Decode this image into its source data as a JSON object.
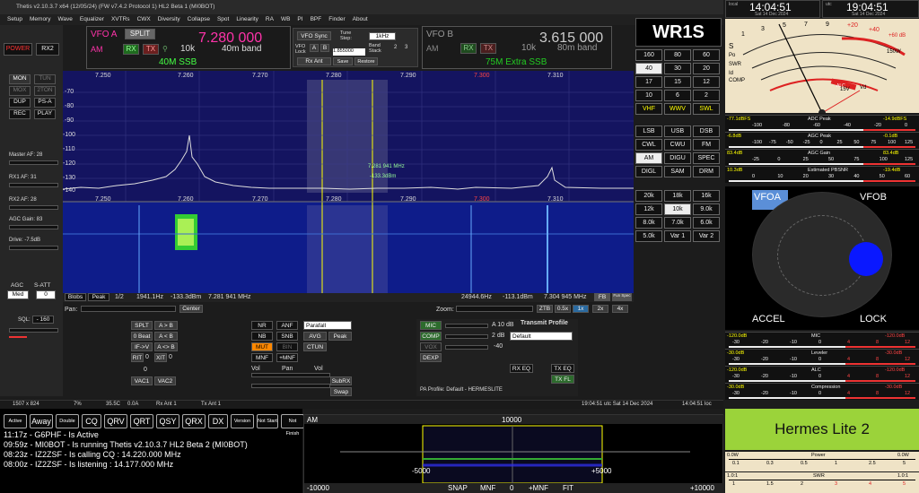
{
  "window": {
    "title": "Thetis v2.10.3.7 x64 (12/05/24) (FW v7.4.2 Protocol 1) HL2 Beta 1 (MI0BOT)"
  },
  "menu": [
    "Setup",
    "Memory",
    "Wave",
    "Equalizer",
    "XVTRs",
    "CWX",
    "Diversity",
    "Collapse",
    "Spot",
    "Linearity",
    "RA",
    "WB",
    "PI",
    "BPF",
    "Finder",
    "About"
  ],
  "left": {
    "power": "POWER",
    "rx2": "RX2",
    "mon": "MON",
    "tun": "TUN",
    "mox": "MOX",
    "twotone": "2TON",
    "dup": "DUP",
    "psa": "PS-A",
    "rec": "REC",
    "play": "PLAY",
    "master_af": "Master AF:  28",
    "rx1_af": "RX1 AF:  31",
    "rx2_af": "RX2 AF:  28",
    "agc_gain": "AGC Gain:  83",
    "drive": "Drive:  -7.5dB",
    "agc": "AGC",
    "satt": "S-ATT",
    "agc_mode": "Med",
    "satt_val": "0",
    "sql": "SQL:",
    "sql_val": "- 160"
  },
  "vfoA": {
    "label": "VFO A",
    "split": "SPLIT",
    "freq": "7.280 000",
    "mode": "AM",
    "rx": "RX",
    "tx": "TX",
    "step": "10k",
    "band": "40m band",
    "band_name": "40M SSB"
  },
  "vfoSync": {
    "sync": "VFO Sync",
    "tune": "Tune Step:",
    "step": "1kHz",
    "lock": "VFO Lock",
    "a": "A",
    "b": "B",
    "bandstack": "Band Stack",
    "bs1": "2",
    "bs2": "3",
    "rxant": "Rx Ant",
    "save": "Save",
    "restore": "Restore",
    "mem": "1.855000"
  },
  "vfoB": {
    "label": "VFO B",
    "freq": "3.615 000",
    "mode": "AM",
    "rx": "RX",
    "tx": "TX",
    "step": "10k",
    "band": "80m band",
    "band_name": "75M Extra SSB"
  },
  "callsign": "WR1S",
  "bands": [
    "160",
    "80",
    "60",
    "40",
    "30",
    "20",
    "17",
    "15",
    "12",
    "10",
    "6",
    "2",
    "VHF",
    "WWV",
    "SWL"
  ],
  "modes": [
    "LSB",
    "USB",
    "DSB",
    "CWL",
    "CWU",
    "FM",
    "AM",
    "DIGU",
    "SPEC",
    "DIGL",
    "SAM",
    "DRM"
  ],
  "filters": [
    "20k",
    "18k",
    "16k",
    "12k",
    "10k",
    "9.0k",
    "8.0k",
    "7.0k",
    "6.0k",
    "5.0k",
    "Var 1",
    "Var 2"
  ],
  "panadapter": {
    "freqs": [
      "7.250",
      "7.260",
      "7.270",
      "7.280",
      "7.290",
      "7.300",
      "7.310"
    ],
    "db": [
      "-70",
      "-80",
      "-90",
      "-100",
      "-110",
      "-120",
      "-130",
      "-140"
    ],
    "cursor_freq": "7.281 941 MHz",
    "cursor_db": "-133.3dBm",
    "bottom_hz": "1941.1Hz",
    "bottom_dbm": "-133.3dBm",
    "bottom_mhz": "7.281 941 MHz",
    "right_hz": "24944.6Hz",
    "right_dbm": "-113.1dBm",
    "right_mhz": "7.304 945 MHz",
    "blobs": "Blobs",
    "peak": "Peak",
    "half": "1/2",
    "fb": "FB",
    "fun": "Fun Spec",
    "pan": "Pan:",
    "center": "Center",
    "zoom": "Zoom:",
    "ztb": "ZTB",
    "z05": "0.5x",
    "z1": "1x",
    "z2": "2x",
    "z4": "4x"
  },
  "dsp": {
    "split": "SPLT",
    "ab": "A > B",
    "zerobeat": "0 Beat",
    "atob": "A < B",
    "ifv": "IF->V",
    "aswap": "A <> B",
    "rit": "RIT",
    "rit_val": "0",
    "xit": "XIT",
    "xit_val": "0",
    "vac1": "VAC1",
    "vac2": "VAC2",
    "vac_val": "0",
    "nr": "NR",
    "anf": "ANF",
    "nb": "NB",
    "snb": "SNB",
    "mut": "MUT",
    "bin": "BIN",
    "mnf": "MNF",
    "pmnf": "+MNF",
    "parafall": "Parafall",
    "avg": "AVG",
    "peak": "Peak",
    "ctun": "CTUN",
    "vol": "Vol",
    "pan": "Pan",
    "vol2": "Vol",
    "subrx": "SubRX",
    "swap": "Swap"
  },
  "tx": {
    "mic": "MIC",
    "comp": "COMP",
    "vox": "VOX",
    "dexp": "DEXP",
    "mic_val": "A 10 dB",
    "comp_val": "2 dB",
    "vox_val": "-40",
    "profile_label": "Transmit Profile",
    "profile": "Default",
    "rxeq": "RX EQ",
    "txeq": "TX EQ",
    "txfl": "TX FL",
    "pa_profile": "PA Profile: Default - HERMESLITE"
  },
  "status": {
    "res": "1507 x 824",
    "cpu": "7%",
    "temp": "35.5C",
    "amps": "0.0A",
    "rxant": "Rx Ant 1",
    "txant": "Tx Ant 1",
    "utc": "19:04:51 utc  Sat 14 Dec 2024",
    "loc": "14:04:51 loc"
  },
  "chat": {
    "buttons": [
      "Active",
      "Away",
      "Double",
      "CQ",
      "QRV",
      "QRT",
      "QSY",
      "QRX",
      "DX",
      "Version",
      "Not Start",
      "Not Finish"
    ],
    "lines": [
      "11:17z - G6PHF - Is Active",
      "09:59z - MI0BOT - Is running Thetis v2.10.3.7 HL2 Beta 2 (MI0BOT)",
      "08:23z - IZ2ZSF - Is calling CQ : 14.220.000 MHz",
      "08:00z - IZ2ZSF - Is listening : 14.177.000 MHz"
    ]
  },
  "spectrum": {
    "mode": "AM",
    "center": "10000",
    "neg": "-5000",
    "pos": "+5000",
    "left": "-10000",
    "right": "+10000",
    "snap": "SNAP",
    "mnf": "MNF",
    "zero": "0",
    "pmnf": "+MNF",
    "fit": "FIT"
  },
  "clocks": {
    "local_label": "local",
    "local_time": "14:04:51",
    "local_date": "Sat 14 Dec 2024",
    "utc_label": "utc",
    "utc_time": "19:04:51",
    "utc_date": "Sat 14 Dec 2024"
  },
  "analog_meter": {
    "s": "S",
    "po": "Po",
    "swr": "SWR",
    "id": "Id",
    "comp": "COMP",
    "vd": "Vd",
    "v15": "15V",
    "s1": "1",
    "s3": "3",
    "s5": "5",
    "s7": "7",
    "s9": "9",
    "p20": "+20",
    "p40": "+40",
    "p60": "+60 dB",
    "w150": "150W",
    "alc": "ALC"
  },
  "meters": [
    {
      "left": "-77.1dBFS",
      "title": "ADC Peak",
      "right": "-14.9dBFS",
      "ticks": [
        "-100",
        "-80",
        "-60",
        "-40",
        "-20",
        "0"
      ]
    },
    {
      "left": "-6.8dB",
      "title": "AGC Peak",
      "right": "-0.1dB",
      "ticks": [
        "-100",
        "-75",
        "-50",
        "-25",
        "0",
        "25",
        "50",
        "75",
        "100",
        "125"
      ]
    },
    {
      "left": "83.4dB",
      "title": "AGC Gain",
      "right": "83.4dB",
      "ticks": [
        "-25",
        "0",
        "25",
        "50",
        "75",
        "100",
        "125"
      ]
    },
    {
      "left": "10.3dB",
      "title": "Estimated PBSNR",
      "right": "-19.4dB",
      "ticks": [
        "0",
        "10",
        "20",
        "30",
        "40",
        "50",
        "60"
      ]
    }
  ],
  "vfo_knob": {
    "vfoa": "VFOA",
    "vfob": "VFOB",
    "accel": "ACCEL",
    "lock": "LOCK"
  },
  "tx_meters": [
    {
      "left": "-120.0dB",
      "title": "MIC",
      "right": "-120.0dB"
    },
    {
      "left": "-30.0dB",
      "title": "Leveler",
      "right": "-30.0dB"
    },
    {
      "left": "-120.0dB",
      "title": "ALC",
      "right": "-120.0dB"
    },
    {
      "left": "-30.0dB",
      "title": "Compression",
      "right": "-30.0dB"
    }
  ],
  "tx_ticks": [
    "-30",
    "-20",
    "-10",
    "0",
    "4",
    "8",
    "12"
  ],
  "radio_name": "Hermes Lite 2",
  "power": {
    "title": "Power",
    "left": "0.0W",
    "right": "0.0W",
    "ticks": [
      "0.1",
      "0.3",
      "0.5",
      "1",
      "2.5",
      "5"
    ]
  },
  "swr": {
    "title": "SWR",
    "left": "1.0:1",
    "right": "1.0:1",
    "ticks": [
      "1",
      "1.5",
      "2",
      "3",
      "4",
      "5"
    ]
  }
}
